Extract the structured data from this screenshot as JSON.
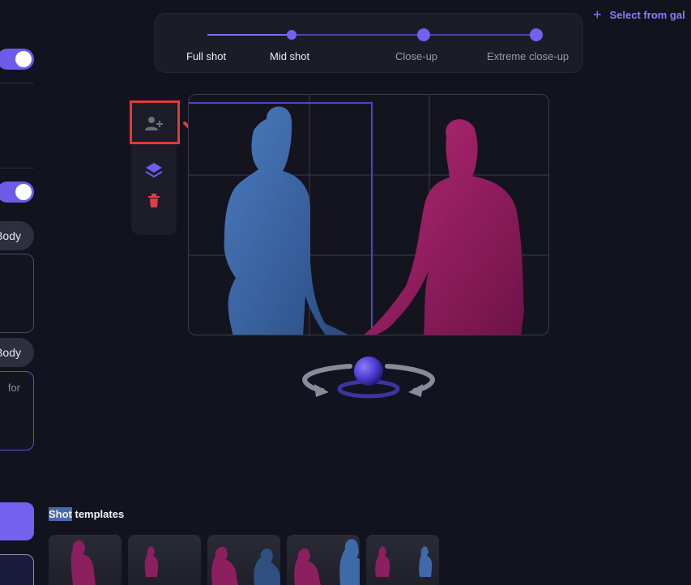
{
  "header": {
    "select_from_gallery": "Select from gal"
  },
  "shot_sizes": {
    "items": [
      {
        "label": "Full shot"
      },
      {
        "label": "Mid shot"
      },
      {
        "label": "Close-up"
      },
      {
        "label": "Extreme close-up"
      }
    ],
    "selected": "Mid shot"
  },
  "left_panel": {
    "body_button_1": "Body",
    "body_button_2": "Body",
    "prompt_placeholder_fragment": "for",
    "toggle_1_on": true,
    "toggle_2_on": true
  },
  "toolbar": {
    "icons": [
      "add-person-icon",
      "layers-icon",
      "trash-icon"
    ]
  },
  "templates": {
    "title_selected_part": "Shot",
    "title_rest": " templates",
    "count": 5
  },
  "colors": {
    "accent": "#7460f0",
    "highlight_box": "#e53935",
    "figure_blue": "#3f6aa8",
    "figure_pink": "#9b1f63"
  }
}
